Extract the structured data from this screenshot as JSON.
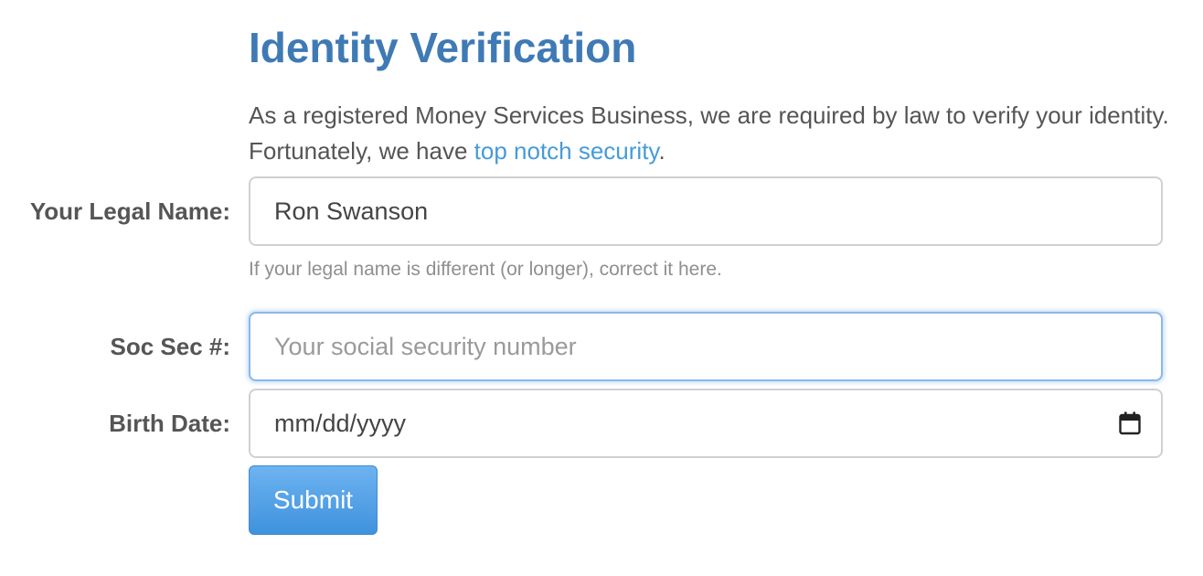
{
  "header": {
    "title": "Identity Verification"
  },
  "intro": {
    "text_before": "As a registered Money Services Business, we are required by law to verify your identity. Fortunately, we have ",
    "link_text": "top notch security",
    "text_after": "."
  },
  "form": {
    "legal_name": {
      "label": "Your Legal Name:",
      "value": "Ron Swanson",
      "help": "If your legal name is different (or longer), correct it here."
    },
    "ssn": {
      "label": "Soc Sec #:",
      "value": "",
      "placeholder": "Your social security number"
    },
    "birth_date": {
      "label": "Birth Date:",
      "value": "mm/dd/yyyy",
      "icon": "calendar-icon"
    },
    "submit_label": "Submit"
  },
  "colors": {
    "title": "#3f7ab5",
    "link": "#459bd8",
    "button": "#4a9be2",
    "focus_border": "#8ab8e8"
  }
}
